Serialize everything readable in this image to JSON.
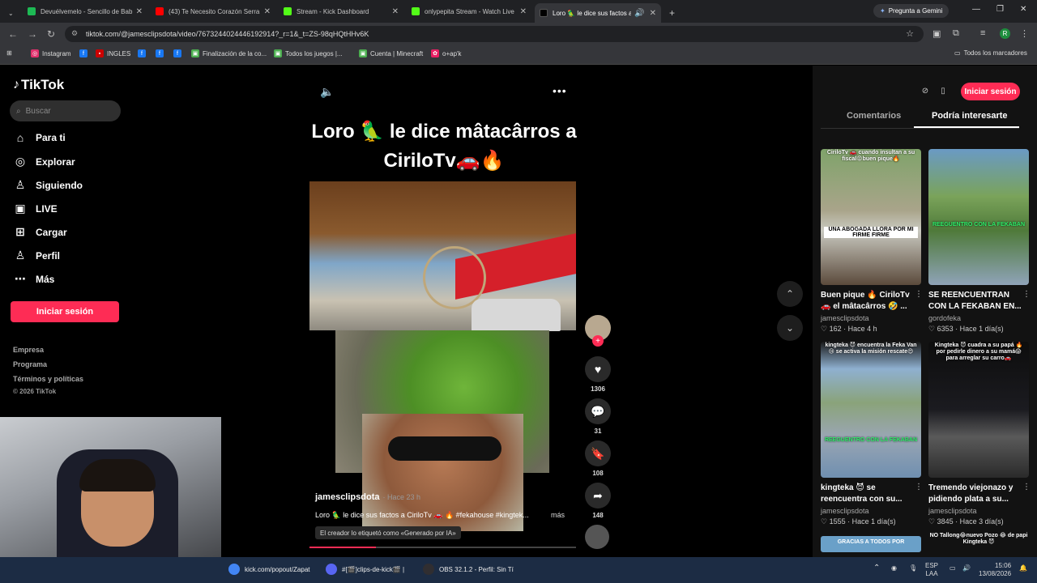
{
  "browser": {
    "tabs": [
      {
        "title": "Devuélvemelo - Sencillo de Bab",
        "color": "#1db954"
      },
      {
        "title": "(43) Te Necesito Corazón Serra",
        "color": "#ff0000"
      },
      {
        "title": "Stream - Kick Dashboard",
        "color": "#53fc18"
      },
      {
        "title": "onlypepita Stream - Watch Live",
        "color": "#53fc18"
      },
      {
        "title": "Loro 🦜 le dice sus factos a",
        "color": "#000000"
      }
    ],
    "gemini_label": "Pregunta a Gemini",
    "url": "tiktok.com/@jamesclipsdota/video/7673244024446192914?_r=1&_t=ZS-98qHQtHHv6K",
    "profile_initial": "R",
    "bookmarks": [
      {
        "label": "Instagram",
        "color": "#e1306c",
        "glyph": "◎"
      },
      {
        "label": "",
        "color": "#1877f2",
        "glyph": "f"
      },
      {
        "label": "INGLES",
        "color": "#cc0000",
        "glyph": "▪"
      },
      {
        "label": "",
        "color": "#1877f2",
        "glyph": "f"
      },
      {
        "label": "",
        "color": "#1877f2",
        "glyph": "f"
      },
      {
        "label": "",
        "color": "#1877f2",
        "glyph": "f"
      },
      {
        "label": "Finalización de la co...",
        "color": "#4caf50",
        "glyph": "▣"
      },
      {
        "label": "Todos los juegos |...",
        "color": "#4caf50",
        "glyph": "▣"
      },
      {
        "label": "Cuenta | Minecraft",
        "color": "#4caf50",
        "glyph": "▣"
      },
      {
        "label": "o+ap'k",
        "color": "#e91e63",
        "glyph": "✿"
      }
    ],
    "all_bookmarks": "Todos los marcadores"
  },
  "tiktok": {
    "brand": "TikTok",
    "search_placeholder": "Buscar",
    "nav": [
      {
        "label": "Para ti",
        "icon": "home-icon",
        "glyph": "⌂"
      },
      {
        "label": "Explorar",
        "icon": "compass-icon",
        "glyph": "◎"
      },
      {
        "label": "Siguiendo",
        "icon": "person-icon",
        "glyph": "♙"
      },
      {
        "label": "LIVE",
        "icon": "live-icon",
        "glyph": "▣"
      },
      {
        "label": "Cargar",
        "icon": "upload-icon",
        "glyph": "⊞"
      },
      {
        "label": "Perfil",
        "icon": "profile-icon",
        "glyph": "♙"
      },
      {
        "label": "Más",
        "icon": "more-icon",
        "glyph": "⋯"
      }
    ],
    "login_label": "Iniciar sesión",
    "footer": [
      "Empresa",
      "Programa",
      "Términos y políticas"
    ],
    "copyright": "© 2026 TikTok"
  },
  "video": {
    "title_line1": "Loro 🦜 le dice mâtacârros a",
    "title_line2": "CiriloTv🚗🔥",
    "author": "jamesclipsdota",
    "posted": "· Hace 23 h",
    "description": "Loro 🦜 le dice sus factos a CiriloTv 🚗 🔥 #fekahouse #kingtek...",
    "more_label": "más",
    "ai_tag": "El creador lo etiquetó como «Generado por IA»",
    "progress": 0.25,
    "likes": "1306",
    "comments": "31",
    "saves": "108",
    "shares": "148"
  },
  "right_panel": {
    "tabs": [
      "Comentarios",
      "Podría interesarte"
    ],
    "login_label": "Iniciar sesión",
    "cards": [
      {
        "title": "Buen pique 🔥 CiriloTv 🚗 el mâtacârros 🤣 ...",
        "user": "jamesclipsdota",
        "likes": "162",
        "when": "Hace 4 h",
        "cap_top": "CiriloTv 🚗 cuando insultan a su fiscal😡buen pique🔥",
        "cap_mid": "UNA ABOGADA LLORA POR MI FIRME FIRME",
        "bg": "linear-gradient(180deg,#7fa36a 0%,#a9a48a 45%,#c9c9c0 60%,#5b4a3b 100%)"
      },
      {
        "title": "SE REENCUENTRAN CON LA FEKABAN EN...",
        "user": "gordofeka",
        "likes": "6353",
        "when": "Hace 1 día(s)",
        "cap_top": "",
        "cap_mid": "REEGUENTRO CON LA FEKABAN",
        "bg": "linear-gradient(180deg,#6a9ac4 0%,#7aa35a 35%,#4f7a3a 60%,#8fa3b8 100%)"
      },
      {
        "title": "kingteka 😈 se reencuentra con su...",
        "user": "jamesclipsdota",
        "likes": "1555",
        "when": "Hace 1 día(s)",
        "cap_top": "kingteka 😈 encuentra la Feka Van😢 se activa la misión rescate😍",
        "cap_mid": "REEGUENTRO CON LA FEKABAN",
        "bg": "linear-gradient(180deg,#1a1a1a 0%,#8fb0d0 20%,#8aa37a 45%,#9aa6b3 70%,#6f8fb0 100%)"
      },
      {
        "title": "Tremendo viejonazo y pidiendo plata a su...",
        "user": "jamesclipsdota",
        "likes": "3845",
        "when": "Hace 3 día(s)",
        "cap_top": "Kingteka 😈 cuadra a su papá 🔥 por pedirle dinero a su mamá😱 para arreglar su carro🚗",
        "cap_mid": "",
        "bg": "linear-gradient(180deg,#0d0d0d 0%,#1b1b20 50%,#5a5a5a 70%,#2a2a2a 100%)"
      }
    ],
    "next_top": "GRACIAS A TODOS POR",
    "next_top2": "NO Tallong😂nuevo Pozo 😂 de papi Kingteka 😈"
  },
  "taskbar": {
    "items": [
      {
        "label": "kick.com/popout/Zapat",
        "color": "#4285f4"
      },
      {
        "label": "#[🎬]clips-de-kick🎬 |",
        "color": "#5865f2"
      },
      {
        "label": "OBS 32.1.2 - Perfil: Sin Tí",
        "color": "#302e31"
      }
    ],
    "lang_top": "ESP",
    "lang_bottom": "LAA",
    "time": "15:06",
    "date": "13/08/2026"
  }
}
